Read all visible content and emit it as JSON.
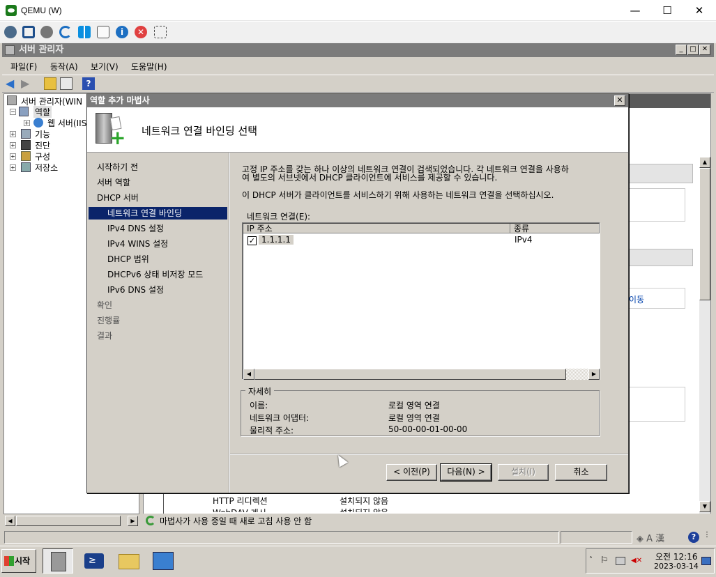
{
  "qemu": {
    "title": "QEMU (W)",
    "minimize": "—",
    "maximize": "☐",
    "close": "✕"
  },
  "server_manager": {
    "title": "서버 관리자",
    "menus": [
      "파일(F)",
      "동작(A)",
      "보기(V)",
      "도움말(H)"
    ],
    "tree": {
      "root": "서버 관리자(WIN",
      "roles": "역할",
      "web_server": "웹 서버(IIS",
      "features": "기능",
      "diagnostics": "진단",
      "configuration": "구성",
      "storage": "저장소"
    },
    "right_pane": {
      "link_fragment": "이동",
      "rows": [
        {
          "name": "HTTP 리디렉션",
          "status": "설치되지 않음"
        },
        {
          "name": "WebDAV 게시",
          "status": "설치되지 않음"
        }
      ]
    },
    "status_text": "마법사가 사용 중일 때 새로 고침 사용 안 함"
  },
  "wizard": {
    "title": "역할 추가 마법사",
    "heading": "네트워크 연결 바인딩 선택",
    "nav": [
      {
        "label": "시작하기 전"
      },
      {
        "label": "서버 역할"
      },
      {
        "label": "DHCP 서버"
      },
      {
        "label": "네트워크 연결 바인딩"
      },
      {
        "label": "IPv4 DNS 설정"
      },
      {
        "label": "IPv4 WINS 설정"
      },
      {
        "label": "DHCP 범위"
      },
      {
        "label": "DHCPv6 상태 비저장 모드"
      },
      {
        "label": "IPv6 DNS 설정"
      },
      {
        "label": "확인"
      },
      {
        "label": "진행률"
      },
      {
        "label": "결과"
      }
    ],
    "description_line1": "고정 IP 주소를 갖는 하나 이상의 네트워크 연결이 검색되었습니다. 각 네트워크 연결을 사용하",
    "description_line2": "여 별도의 서브넷에서 DHCP 클라이언트에 서비스를 제공할 수 있습니다.",
    "instruction": "이 DHCP 서버가 클라이언트를 서비스하기 위해 사용하는 네트워크 연결을 선택하십시오.",
    "list_label": "네트워크 연결(E):",
    "columns": {
      "ip": "IP 주소",
      "type": "종류"
    },
    "connections": [
      {
        "ip": "1.1.1.1",
        "type": "IPv4",
        "checked": true
      }
    ],
    "details": {
      "legend": "자세히",
      "name_label": "이름:",
      "name_value": "로컬 영역 연결",
      "adapter_label": "네트워크 어댑터:",
      "adapter_value": "로컬 영역 연결",
      "mac_label": "물리적 주소:",
      "mac_value": "50-00-00-01-00-00"
    },
    "buttons": {
      "back": "< 이전(P)",
      "next": "다음(N) >",
      "install": "설치(I)",
      "cancel": "취소"
    }
  },
  "taskbar": {
    "start": "시작",
    "time": "오전 12:16",
    "date": "2023-03-14"
  }
}
